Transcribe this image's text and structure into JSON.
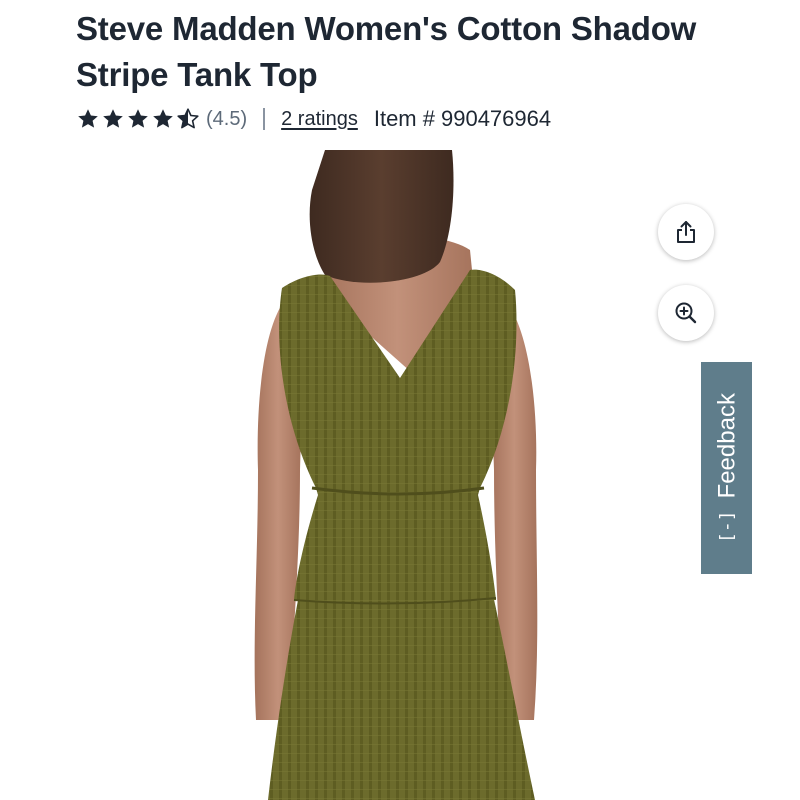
{
  "product": {
    "title": "Steve Madden Women's Cotton Shadow Stripe Tank Top",
    "rating_value": "(4.5)",
    "rating_stars": 4.5,
    "rating_max": 5,
    "ratings_link": "2 ratings",
    "item_prefix": "Item #",
    "item_number": "990476964"
  },
  "actions": {
    "share_icon": "share-icon",
    "zoom_icon": "zoom-in-icon"
  },
  "feedback": {
    "icon_text": "[-]",
    "label": "Feedback"
  },
  "colors": {
    "title_text": "#1e2733",
    "star": "#1e2733",
    "feedback_bg": "#5f7d8b",
    "garment": "#6b6a2a"
  }
}
